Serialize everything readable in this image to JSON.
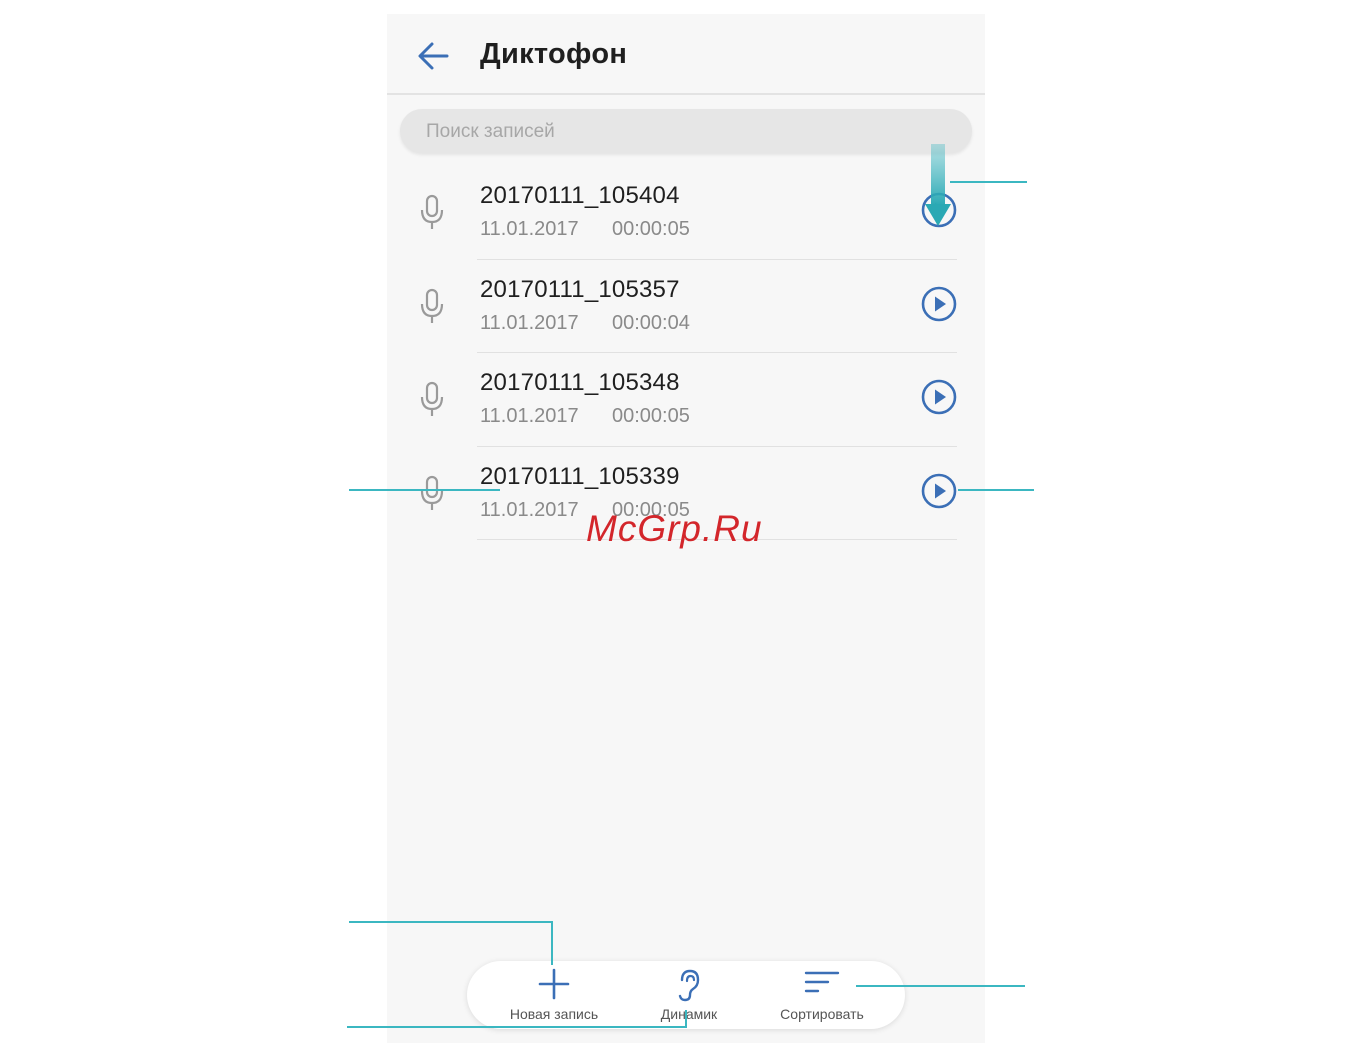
{
  "header": {
    "title": "Диктофон"
  },
  "search": {
    "placeholder": "Поиск записей"
  },
  "recordings": [
    {
      "name": "20170111_105404",
      "date": "11.01.2017",
      "duration": "00:00:05"
    },
    {
      "name": "20170111_105357",
      "date": "11.01.2017",
      "duration": "00:00:04"
    },
    {
      "name": "20170111_105348",
      "date": "11.01.2017",
      "duration": "00:00:05"
    },
    {
      "name": "20170111_105339",
      "date": "11.01.2017",
      "duration": "00:00:05"
    }
  ],
  "bottom_bar": {
    "new_record_label": "Новая запись",
    "speaker_label": "Динамик",
    "sort_label": "Сортировать"
  },
  "watermark": "McGrp.Ru",
  "colors": {
    "accent": "#3b6fb6",
    "callout": "#3bb7c1",
    "watermark": "#d3262b"
  },
  "icons": [
    "back-arrow-icon",
    "microphone-icon",
    "play-icon",
    "plus-icon",
    "ear-icon",
    "sort-icon",
    "pull-down-arrow-icon"
  ]
}
